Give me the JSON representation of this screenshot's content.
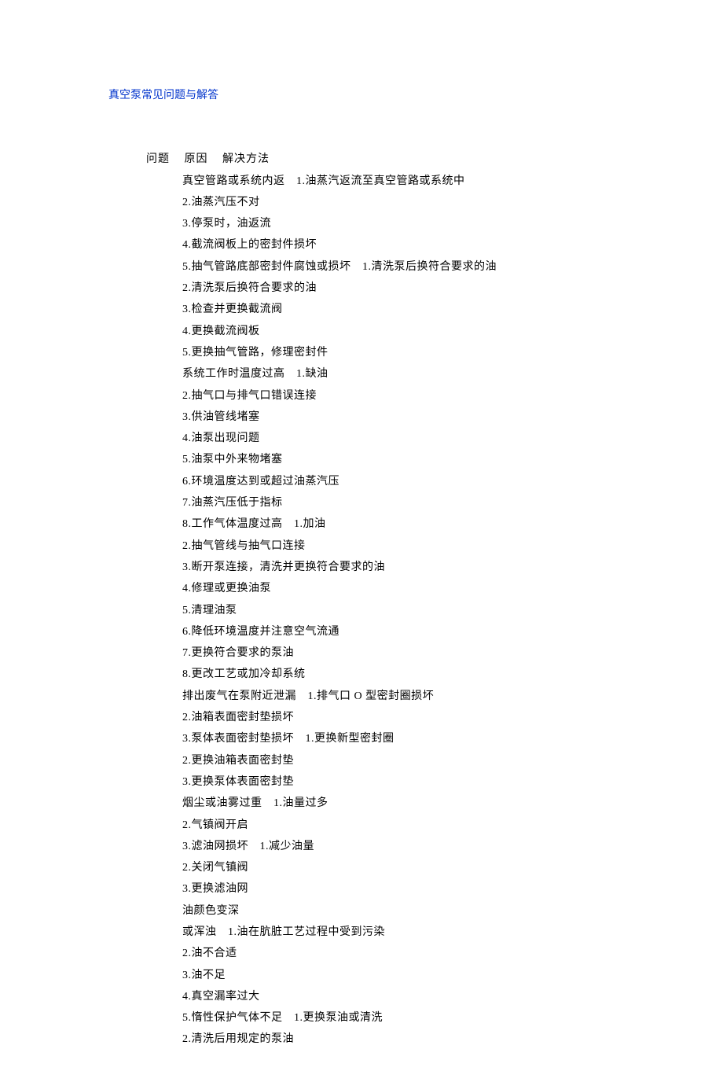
{
  "title": "真空泵常见问题与解答",
  "header": {
    "col1": "问题",
    "col2": "原因",
    "col3": "解决方法"
  },
  "lines": [
    "真空管路或系统内返　1.油蒸汽返流至真空管路或系统中",
    "2.油蒸汽压不对",
    "3.停泵时，油返流",
    "4.截流阀板上的密封件损坏",
    "5.抽气管路底部密封件腐蚀或损坏　1.清洗泵后换符合要求的油",
    "2.清洗泵后换符合要求的油",
    "3.检查并更换截流阀",
    "4.更换截流阀板",
    "5.更换抽气管路，修理密封件",
    "系统工作时温度过高　1.缺油",
    "2.抽气口与排气口错误连接",
    "3.供油管线堵塞",
    "4.油泵出现问题",
    "5.油泵中外来物堵塞",
    "6.环境温度达到或超过油蒸汽压",
    "7.油蒸汽压低于指标",
    "8.工作气体温度过高　1.加油",
    "2.抽气管线与抽气口连接",
    "3.断开泵连接，清洗并更换符合要求的油",
    "4.修理或更换油泵",
    "5.清理油泵",
    "6.降低环境温度并注意空气流通",
    "7.更换符合要求的泵油",
    "8.更改工艺或加冷却系统",
    "排出废气在泵附近泄漏　1.排气口 O 型密封圈损坏",
    "2.油箱表面密封垫损坏",
    "3.泵体表面密封垫损坏　1.更换新型密封圈",
    "2.更换油箱表面密封垫",
    "3.更换泵体表面密封垫",
    "烟尘或油雾过重　1.油量过多",
    "2.气镇阀开启",
    "3.滤油网损坏　1.减少油量",
    "2.关闭气镇阀",
    "3.更换滤油网",
    "油颜色变深",
    "或浑浊　1.油在肮脏工艺过程中受到污染",
    "2.油不合适",
    "3.油不足",
    "4.真空漏率过大",
    "5.惰性保护气体不足　1.更换泵油或清洗",
    "2.清洗后用规定的泵油"
  ]
}
